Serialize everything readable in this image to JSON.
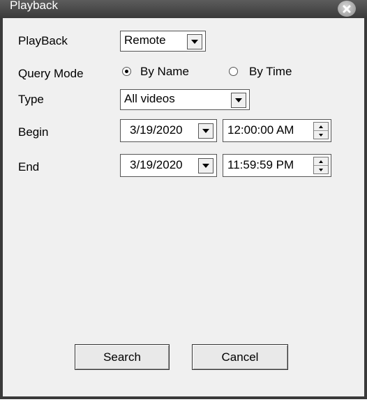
{
  "window": {
    "title": "Playback"
  },
  "form": {
    "playback_label": "PlayBack",
    "playback_value": "Remote",
    "query_mode_label": "Query Mode",
    "radio_by_name": "By Name",
    "radio_by_time": "By Time",
    "radio_selected": "By Name",
    "type_label": "Type",
    "type_value": "All videos",
    "begin_label": "Begin",
    "begin_date": "3/19/2020",
    "begin_time": "12:00:00 AM",
    "end_label": "End",
    "end_date": "3/19/2020",
    "end_time": "11:59:59 PM"
  },
  "buttons": {
    "search": "Search",
    "cancel": "Cancel"
  }
}
